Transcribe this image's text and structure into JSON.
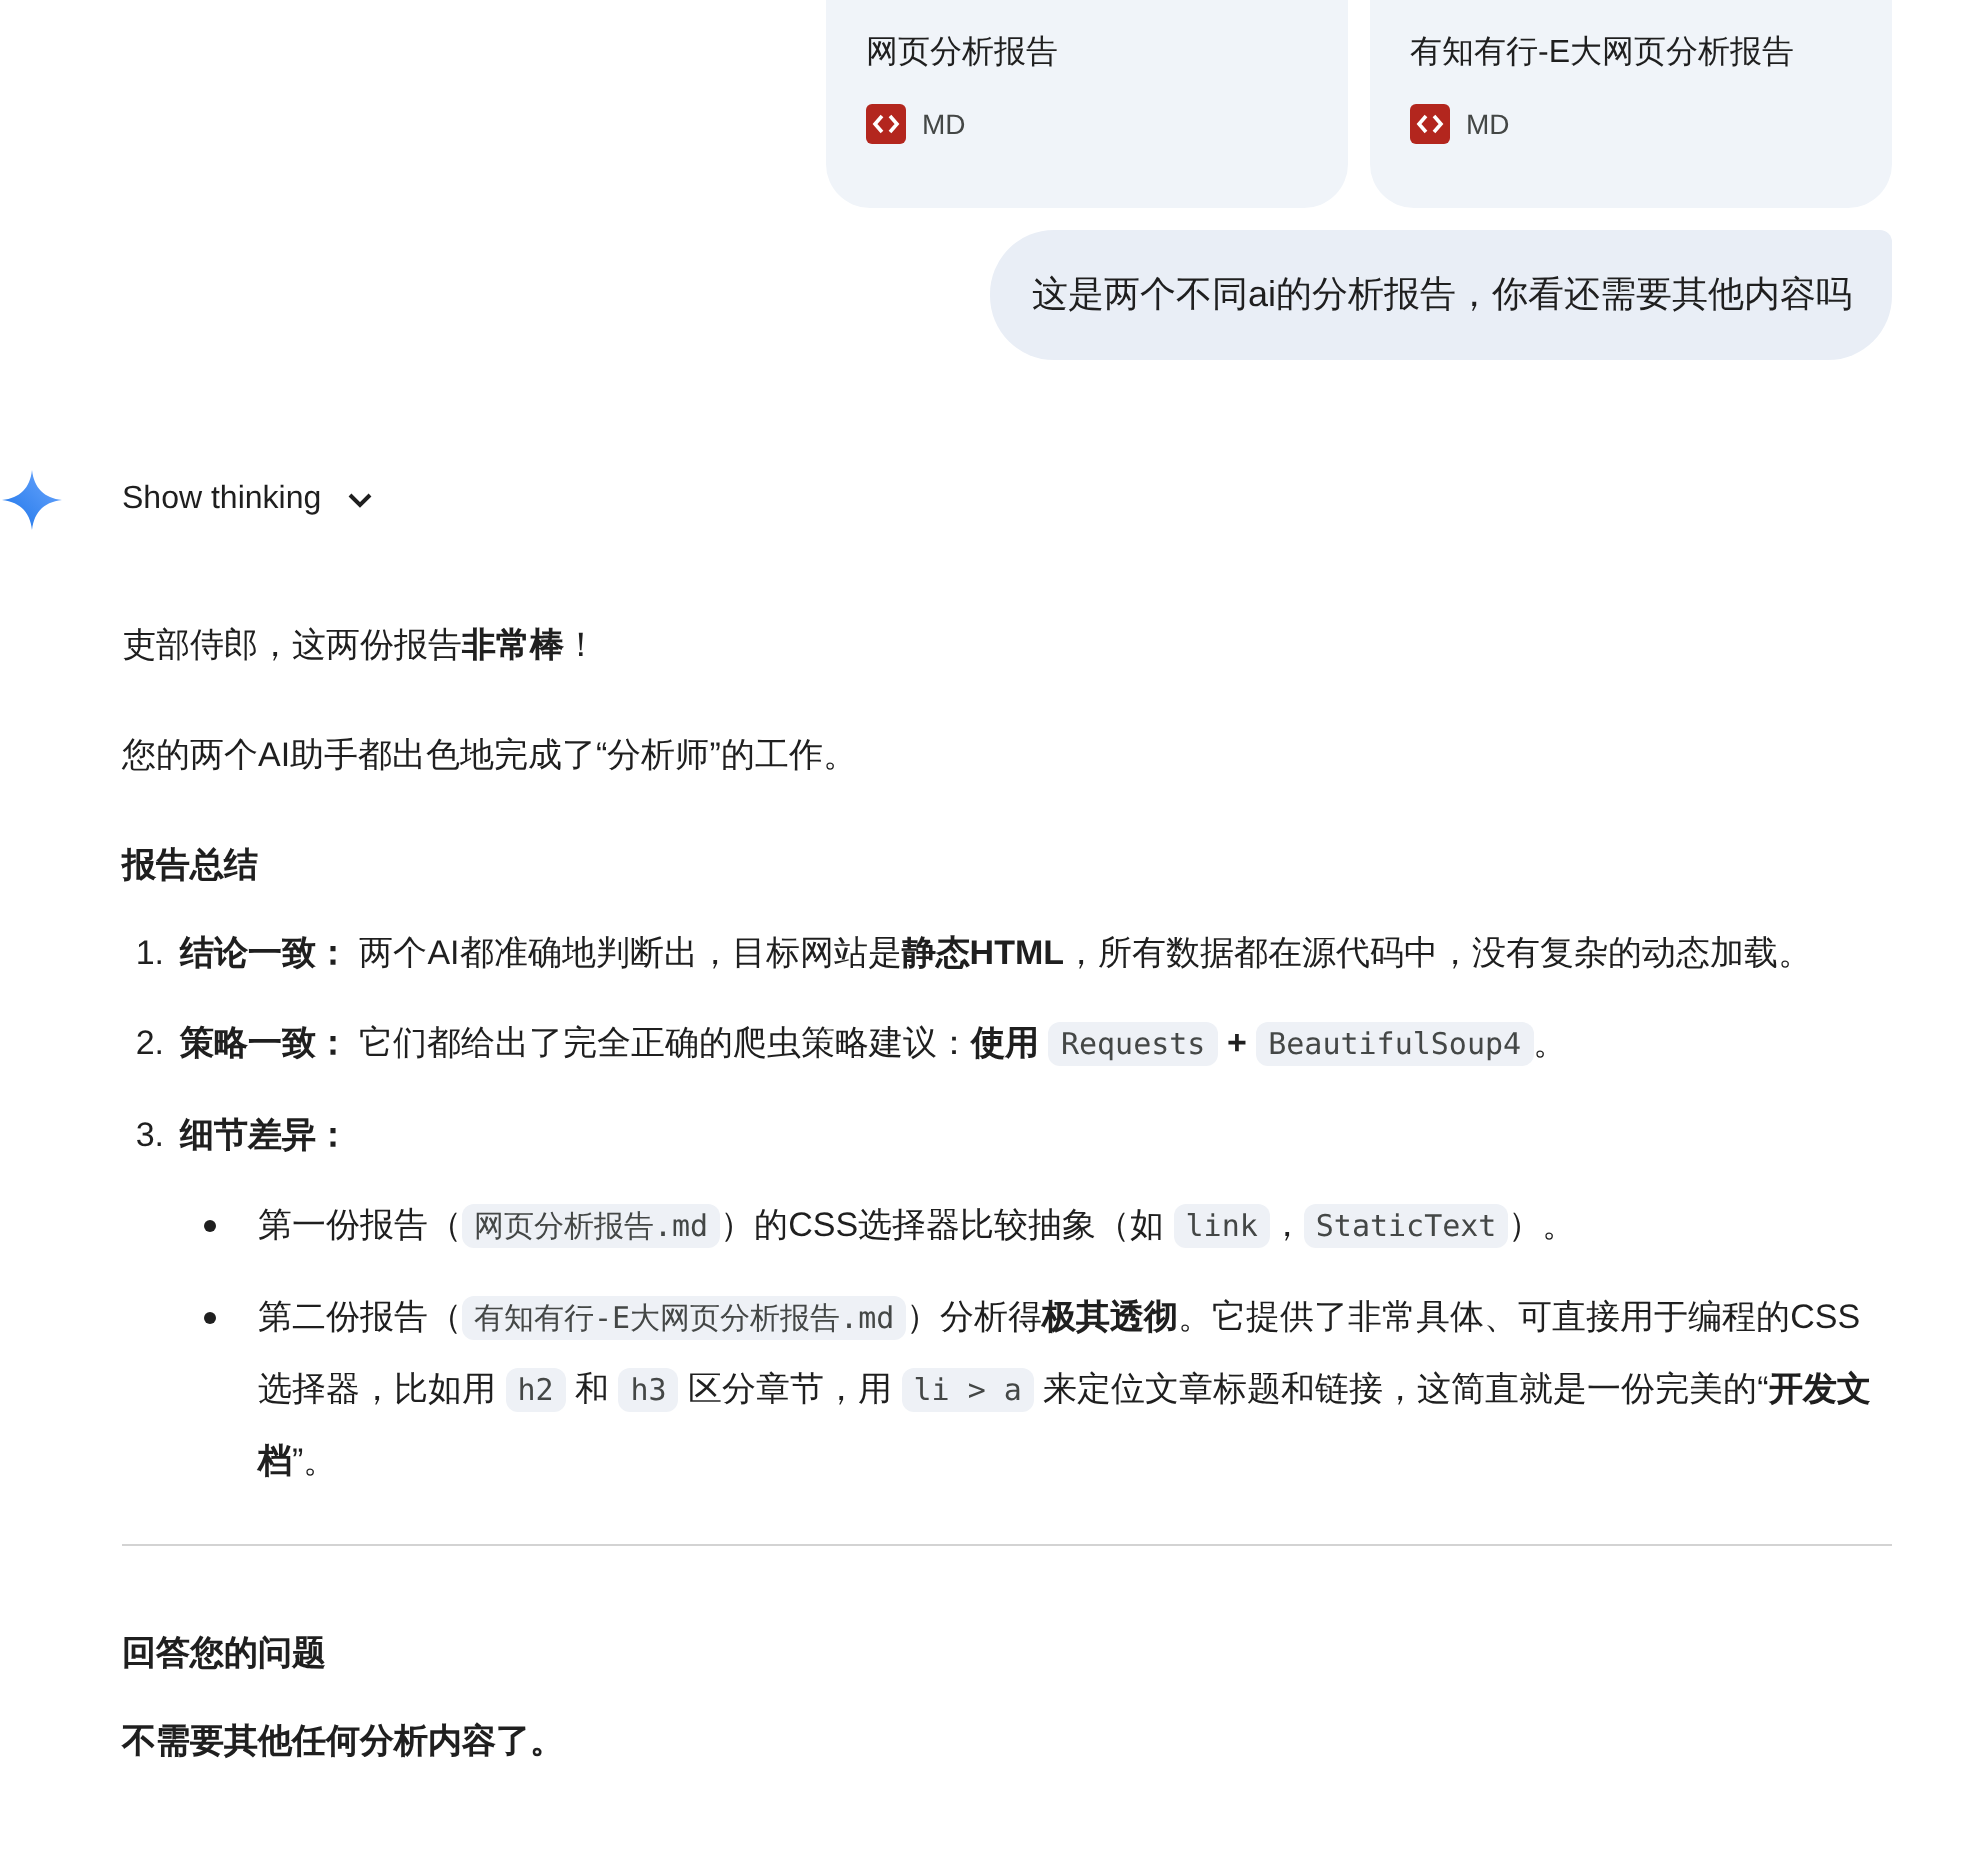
{
  "attachments": [
    {
      "title": "网页分析报告",
      "type": "MD"
    },
    {
      "title": "有知有行-E大网页分析报告",
      "type": "MD"
    }
  ],
  "user_message": "这是两个不同ai的分析报告，你看还需要其他内容吗",
  "thinking": {
    "label": "Show thinking",
    "expanded": false
  },
  "response": [
    {
      "kind": "paragraph",
      "parts": [
        {
          "kind": "text",
          "text": "吏部侍郎，这两份报告**非常棒**！"
        }
      ]
    },
    {
      "kind": "paragraph",
      "parts": [
        {
          "kind": "text",
          "text": "您的两个AI助手都出色地完成了“分析师”的工作。"
        }
      ]
    },
    {
      "kind": "heading",
      "text": "报告总结"
    },
    {
      "kind": "ordered_list",
      "items": [
        {
          "number": "1.",
          "parts": [
            {
              "kind": "text",
              "text": "**结论一致：** 两个AI都准确地判断出，目标网站是**静态HTML**，所有数据都在源代码中，没有复杂的动态加载。"
            }
          ]
        },
        {
          "number": "2.",
          "parts": [
            {
              "kind": "text",
              "text": "**策略一致：** 它们都给出了完全正确的爬虫策略建议：**使用** "
            },
            {
              "kind": "code",
              "text": "Requests"
            },
            {
              "kind": "text",
              "text": " **+** "
            },
            {
              "kind": "code",
              "text": "BeautifulSoup4"
            },
            {
              "kind": "text",
              "text": "。"
            }
          ]
        },
        {
          "number": "3.",
          "parts": [
            {
              "kind": "text",
              "text": "**细节差异：**"
            }
          ],
          "children": [
            {
              "parts": [
                {
                  "kind": "text",
                  "text": "第一份报告（"
                },
                {
                  "kind": "code",
                  "text": "网页分析报告.md"
                },
                {
                  "kind": "text",
                  "text": "）的CSS选择器比较抽象（如 "
                },
                {
                  "kind": "code",
                  "text": "link"
                },
                {
                  "kind": "text",
                  "text": "，"
                },
                {
                  "kind": "code",
                  "text": "StaticText"
                },
                {
                  "kind": "text",
                  "text": "）。"
                }
              ]
            },
            {
              "parts": [
                {
                  "kind": "text",
                  "text": "第二份报告（"
                },
                {
                  "kind": "code",
                  "text": "有知有行-E大网页分析报告.md"
                },
                {
                  "kind": "text",
                  "text": "）分析得**极其透彻**。它提供了非常具体、可直接用于编程的CSS选择器，比如用 "
                },
                {
                  "kind": "code",
                  "text": "h2"
                },
                {
                  "kind": "text",
                  "text": " 和 "
                },
                {
                  "kind": "code",
                  "text": "h3"
                },
                {
                  "kind": "text",
                  "text": " 区分章节，用 "
                },
                {
                  "kind": "code",
                  "text": "li > a"
                },
                {
                  "kind": "text",
                  "text": " 来定位文章标题和链接，这简直就是一份完美的“**开发文档**”。"
                }
              ]
            }
          ]
        }
      ]
    },
    {
      "kind": "divider"
    },
    {
      "kind": "heading",
      "text": "回答您的问题"
    },
    {
      "kind": "paragraph",
      "parts": [
        {
          "kind": "text",
          "text": "**不需要其他任何分析内容了。**"
        }
      ]
    }
  ]
}
